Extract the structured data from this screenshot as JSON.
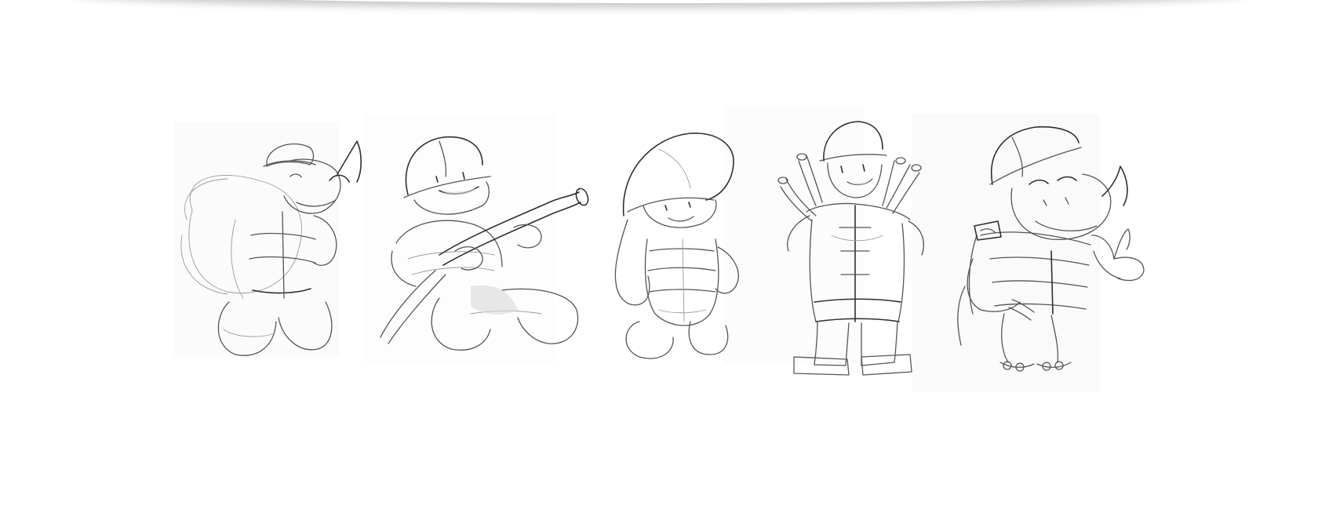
{
  "image": {
    "kind": "pencil-sketch-sheet",
    "background_color": "#ffffff",
    "pencil_color": "#555555"
  },
  "characters": [
    {
      "name": "rhino-firefighter-sketch-1",
      "description": "rhino",
      "pose": "standing"
    },
    {
      "name": "firefighter-with-hose-sketch",
      "description": "firefighter",
      "pose": "kneeling-with-hose"
    },
    {
      "name": "round-firefighter-sketch",
      "description": "firefighter",
      "pose": "standing"
    },
    {
      "name": "firefighter-with-hoses-on-back-sketch",
      "description": "firefighter",
      "pose": "standing"
    },
    {
      "name": "rhino-firefighter-thumbs-up-sketch",
      "description": "rhino",
      "pose": "thumbs-up"
    }
  ]
}
